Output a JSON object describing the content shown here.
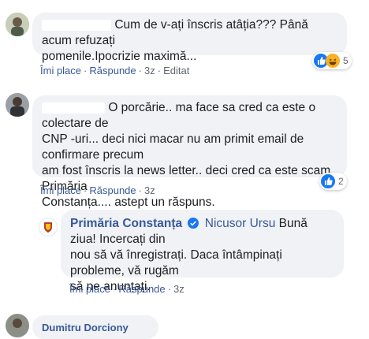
{
  "comments": [
    {
      "text": "Cum de v-ați înscris atâția??? Până acum refuzați pomenile.Ipocrizie maximă...",
      "line1": "Cum de v-ați înscris atâția??? Până acum refuzați",
      "line2": "pomenile.Ipocrizie maximă...",
      "actions": {
        "like": "Îmi place",
        "reply": "Răspunde",
        "time": "3z",
        "edited": "Editat"
      },
      "reactions": {
        "icons": [
          "like-icon",
          "haha-icon"
        ],
        "count": "5"
      }
    },
    {
      "line1": "O porcărie.. ma face sa cred ca este o colectare de",
      "line2": "CNP -uri... deci nici macar nu am primit email de confirmare precum",
      "line3": "am fost înscris la news letter.. deci cred ca este scam. Primăria",
      "line4": "Constanța.... astept un răspuns.",
      "actions": {
        "like": "Îmi place",
        "reply": "Răspunde",
        "time": "3z"
      },
      "reactions": {
        "icons": [
          "like-icon"
        ],
        "count": "2"
      }
    }
  ],
  "reply": {
    "author": "Primăria Constanța",
    "tagged": "Nicusor Ursu",
    "line1_rest": "Bună ziua! Incercați din",
    "line2": "nou să vă înregistrați. Daca întâmpinați probleme, vă rugăm",
    "line3": "să ne anunțați.",
    "actions": {
      "like": "Îmi place",
      "reply": "Răspunde",
      "time": "3z"
    }
  },
  "next_comment": {
    "author_partial": "Dumitru Dorciony"
  },
  "colors": {
    "link": "#385898",
    "bubble": "#f0f2f5",
    "meta": "#606770",
    "like": "#1877f2",
    "verified": "#1877f2"
  }
}
